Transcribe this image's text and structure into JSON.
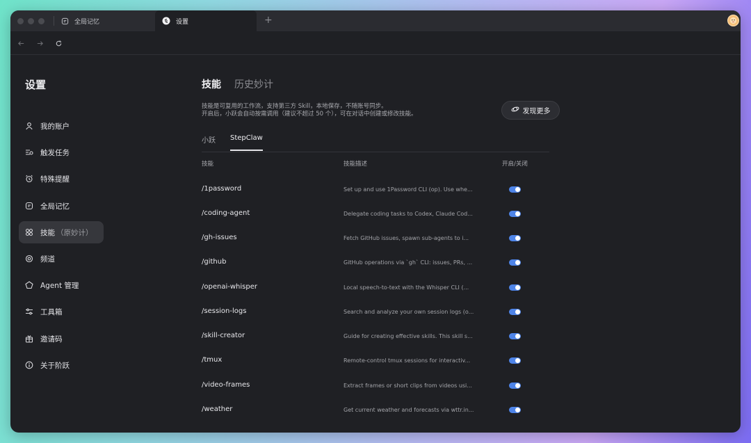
{
  "tabs": [
    {
      "label": "全局记忆",
      "icon": "memory-icon"
    },
    {
      "label": "设置",
      "icon": "app-logo-icon"
    }
  ],
  "sidebar": {
    "title": "设置",
    "items": [
      {
        "label": "我的账户",
        "icon": "user-icon"
      },
      {
        "label": "触发任务",
        "icon": "trigger-icon"
      },
      {
        "label": "特殊提醒",
        "icon": "alarm-icon"
      },
      {
        "label": "全局记忆",
        "icon": "memory-icon"
      },
      {
        "label": "技能",
        "sub": "（原妙计）",
        "icon": "grid-icon",
        "active": true
      },
      {
        "label": "频道",
        "icon": "channel-icon"
      },
      {
        "label": "Agent 管理",
        "icon": "agent-icon"
      },
      {
        "label": "工具箱",
        "icon": "sliders-icon"
      },
      {
        "label": "邀请码",
        "icon": "gift-icon"
      },
      {
        "label": "关于阶跃",
        "icon": "info-icon"
      }
    ]
  },
  "main": {
    "tabs": [
      "技能",
      "历史妙计"
    ],
    "desc_line1": "技能是可复用的工作流，支持第三方 Skill，本地保存，不随账号同步。",
    "desc_line2": "开启后，小跃会自动按需调用（建议不超过 50 个），可在对话中创建或修改技能。",
    "discover_label": "发现更多",
    "subtabs": [
      "小跃",
      "StepClaw"
    ],
    "headers": {
      "name": "技能",
      "desc": "技能描述",
      "toggle": "开启/关闭"
    },
    "skills": [
      {
        "name": "/1password",
        "desc": "Set up and use 1Password CLI (op). Use whe...",
        "enabled": true
      },
      {
        "name": "/coding-agent",
        "desc": "Delegate coding tasks to Codex, Claude Cod...",
        "enabled": true
      },
      {
        "name": "/gh-issues",
        "desc": "Fetch GitHub issues, spawn sub-agents to i...",
        "enabled": true
      },
      {
        "name": "/github",
        "desc": "GitHub operations via `gh` CLI: issues, PRs, ...",
        "enabled": true
      },
      {
        "name": "/openai-whisper",
        "desc": "Local speech-to-text with the Whisper CLI (...",
        "enabled": true
      },
      {
        "name": "/session-logs",
        "desc": "Search and analyze your own session logs (o...",
        "enabled": true
      },
      {
        "name": "/skill-creator",
        "desc": "Guide for creating effective skills. This skill s...",
        "enabled": true
      },
      {
        "name": "/tmux",
        "desc": "Remote-control tmux sessions for interactiv...",
        "enabled": true
      },
      {
        "name": "/video-frames",
        "desc": "Extract frames or short clips from videos usi...",
        "enabled": true
      },
      {
        "name": "/weather",
        "desc": "Get current weather and forecasts via wttr.in...",
        "enabled": true
      }
    ]
  },
  "colors": {
    "accent": "#4e84e8",
    "window_bg": "#1f2024",
    "active_item": "#36373c"
  }
}
